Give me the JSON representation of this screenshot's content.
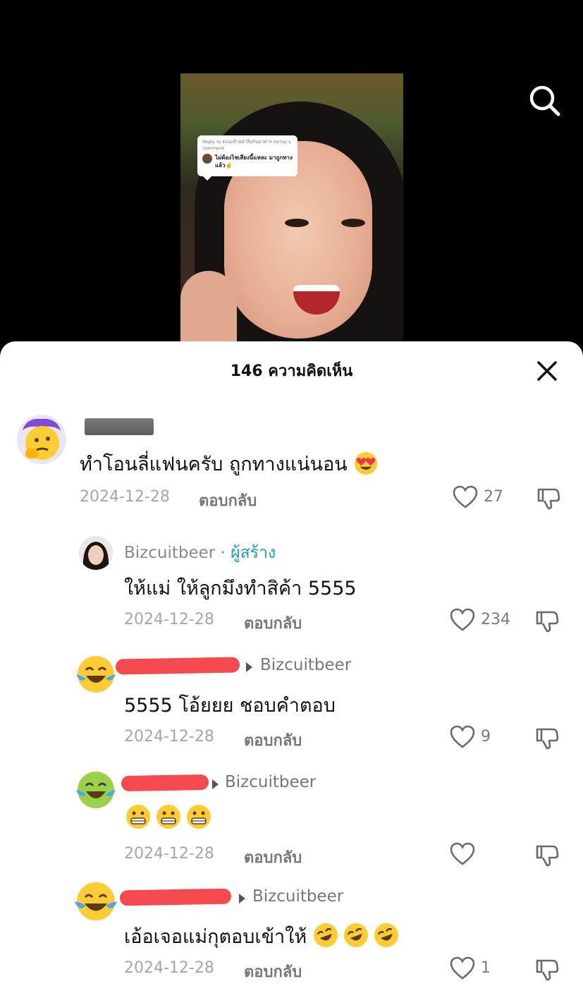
{
  "video": {
    "reply_sticker": {
      "header": "Reply to ตอนเข้าอย่าลืมกินอาหาร แมวนะ's comment",
      "text": "ไม่ต้องไชเสียงนี้แหละ มาถูกทางแล้ว✌️"
    }
  },
  "comments_panel": {
    "title": "146 ความคิดเห็น"
  },
  "comments": [
    {
      "text": "ทำโอนลี่แฟนครับ ถูกทางแน่นอน",
      "date": "2024-12-28",
      "reply_label": "ตอบกลับ",
      "likes": "27"
    },
    {
      "username": "Bizcuitbeer",
      "creator_badge": "· ผู้สร้าง",
      "text": "ให้แม่ ให้ลูกมึงทำสิค้า 5555",
      "date": "2024-12-28",
      "reply_label": "ตอบกลับ",
      "likes": "234"
    },
    {
      "reply_target": "Bizcuitbeer",
      "text": "5555 โอ้ยยย ชอบคำตอบ",
      "date": "2024-12-28",
      "reply_label": "ตอบกลับ",
      "likes": "9"
    },
    {
      "reply_target": "Bizcuitbeer",
      "text": "",
      "date": "2024-12-28",
      "reply_label": "ตอบกลับ",
      "likes": ""
    },
    {
      "reply_target": "Bizcuitbeer",
      "text": "เอ้อเจอแม่กุตอบเข้าให้",
      "date": "2024-12-28",
      "reply_label": "ตอบกลับ",
      "likes": "1"
    }
  ],
  "colors": {
    "creator_badge": "#1f9bc4",
    "redaction": "#f3494f"
  }
}
